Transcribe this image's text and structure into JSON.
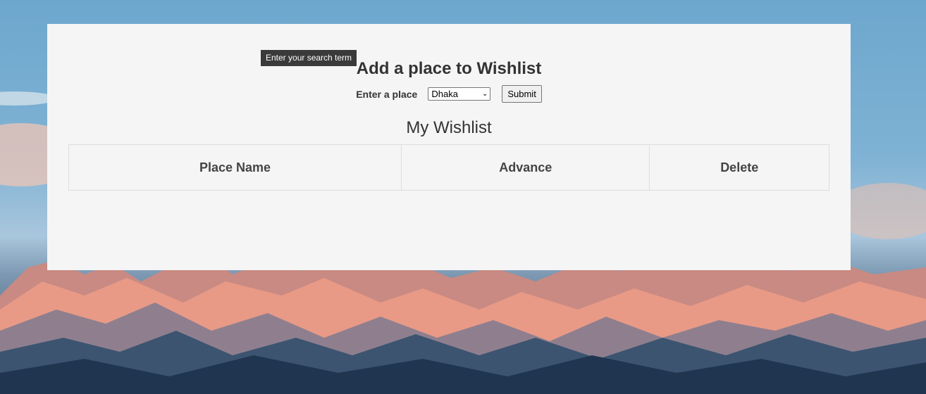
{
  "tooltip": {
    "text": "Enter your search term"
  },
  "form": {
    "title": "Add a place to Wishlist",
    "label": "Enter a place",
    "selected_place": "Dhaka",
    "submit_label": "Submit"
  },
  "wishlist": {
    "title": "My Wishlist",
    "columns": [
      "Place Name",
      "Advance",
      "Delete"
    ]
  }
}
